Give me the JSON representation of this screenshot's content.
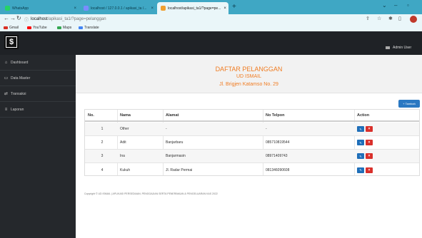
{
  "browser": {
    "tabs": [
      {
        "label": "WhatsApp",
        "close": "×",
        "color": "#25d366"
      },
      {
        "label": "localhost / 127.0.0.1 / apikasi_ta /...",
        "close": "×",
        "color": "#7a8cff"
      },
      {
        "label": "localhost/apikasi_ta1/?page=pe...",
        "close": "×",
        "color": "#f0a030"
      }
    ],
    "new_tab": "+",
    "address": {
      "host": "localhost",
      "path": "/apikasi_ta1/?page=pelanggan"
    },
    "bookmarks": [
      {
        "label": "Gmail",
        "color": "#d93025"
      },
      {
        "label": "YouTube",
        "color": "#ff0000"
      },
      {
        "label": "Maps",
        "color": "#34a853"
      },
      {
        "label": "Translate",
        "color": "#4285f4"
      }
    ]
  },
  "app": {
    "logo_char": "$",
    "user": "Admin User"
  },
  "sidebar": {
    "items": [
      {
        "icon": "home-icon",
        "glyph": "⌂",
        "label": "Dashboard"
      },
      {
        "icon": "monitor-icon",
        "glyph": "▭",
        "label": "Data Master"
      },
      {
        "icon": "exchange-icon",
        "glyph": "⇄",
        "label": "Transaksi"
      },
      {
        "icon": "list-icon",
        "glyph": "≡",
        "label": "Laporan"
      }
    ]
  },
  "header": {
    "title": "DAFTAR PELANGGAN",
    "company": "UD ISMAIL",
    "address": "Jl. Brigjen Katamso No. 29"
  },
  "toolbar": {
    "add_label": "+ Tambah"
  },
  "table": {
    "columns": [
      "No.",
      "Nama",
      "Alamat",
      "No Telpon",
      "Action"
    ],
    "rows": [
      {
        "no": "1",
        "nama": "Other",
        "alamat": "-",
        "telp": "-"
      },
      {
        "no": "2",
        "nama": "Adit",
        "alamat": "Banjarbaru",
        "telp": "085710819544"
      },
      {
        "no": "3",
        "nama": "Ina",
        "alamat": "Banjarmasin",
        "telp": "08971409743"
      },
      {
        "no": "4",
        "nama": "Kukuh",
        "alamat": "Jl. Radar Permai",
        "telp": "081346090608"
      }
    ],
    "edit_label": "✎",
    "delete_label": "×"
  },
  "footer": "Copyright © UD ISMAIL | APLIKASI PERSEDIAAN, PENGGAJIAN SERTA PENERIMAAN & PENGELUARAN KAS 2022"
}
